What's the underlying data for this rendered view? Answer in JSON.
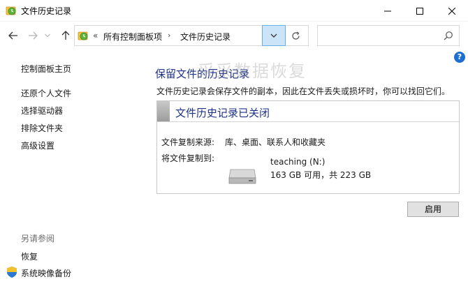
{
  "window": {
    "title": "文件历史记录"
  },
  "address": {
    "overflow": "«",
    "crumbs": [
      "所有控制面板项",
      "文件历史记录"
    ],
    "separator": "›"
  },
  "search": {
    "placeholder": ""
  },
  "help": {
    "label": "?"
  },
  "sidebar": {
    "home": "控制面板主页",
    "links": [
      "还原个人文件",
      "选择驱动器",
      "排除文件夹",
      "高级设置"
    ],
    "see_also": "另请参阅",
    "see_also_links": [
      "恢复",
      "系统映像备份"
    ]
  },
  "watermark": "采采数据恢复",
  "main": {
    "title": "保留文件的历史记录",
    "description": "文件历史记录会保存文件的副本，因此在文件丢失或损坏时，你可以找回它们。",
    "status_title": "文件历史记录已关闭",
    "source_label": "文件复制来源:",
    "source_value": "库、桌面、联系人和收藏夹",
    "dest_label": "将文件复制到:",
    "drive_name": "teaching (N:)",
    "drive_space": "163 GB 可用，共 223 GB",
    "enable_button": "启用"
  },
  "colors": {
    "heading": "#1e3287",
    "accent": "#1c6fd1"
  }
}
